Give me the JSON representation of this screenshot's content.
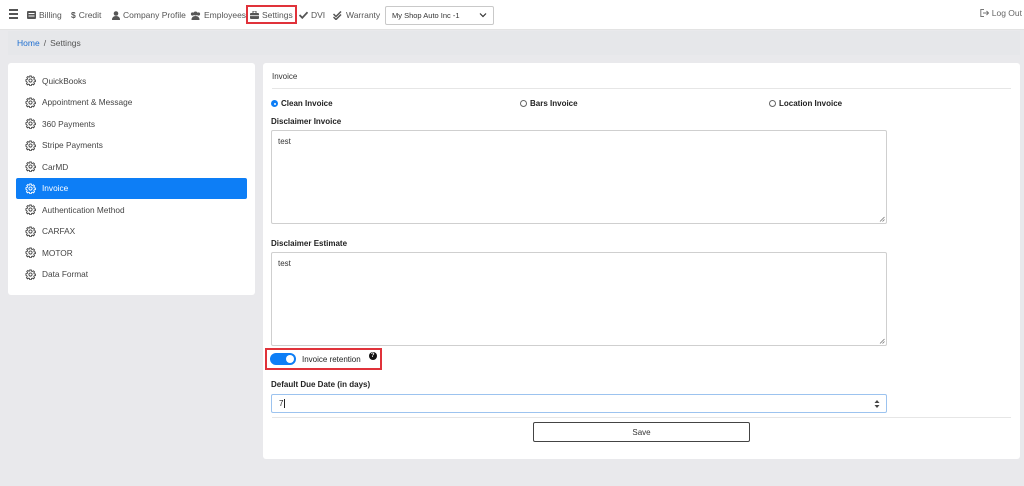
{
  "nav": {
    "items": [
      {
        "label": "Billing",
        "icon": "billing-icon"
      },
      {
        "label": "Credit",
        "icon": "dollar-icon"
      },
      {
        "label": "Company Profile",
        "icon": "user-icon"
      },
      {
        "label": "Employees",
        "icon": "users-icon"
      },
      {
        "label": "Settings",
        "icon": "toolbox-icon"
      },
      {
        "label": "DVI",
        "icon": "check-icon"
      },
      {
        "label": "Warranty",
        "icon": "double-check-icon"
      }
    ],
    "shop_select": "My Shop Auto Inc -1",
    "logout": "Log Out"
  },
  "breadcrumb": {
    "home": "Home",
    "separator": "/",
    "current": "Settings"
  },
  "sidebar": {
    "items": [
      {
        "label": "QuickBooks"
      },
      {
        "label": "Appointment & Message"
      },
      {
        "label": "360 Payments"
      },
      {
        "label": "Stripe Payments"
      },
      {
        "label": "CarMD"
      },
      {
        "label": "Invoice",
        "active": true
      },
      {
        "label": "Authentication Method"
      },
      {
        "label": "CARFAX"
      },
      {
        "label": "MOTOR"
      },
      {
        "label": "Data Format"
      }
    ]
  },
  "invoice": {
    "title": "Invoice",
    "options": [
      {
        "label": "Clean Invoice",
        "checked": true
      },
      {
        "label": "Bars Invoice",
        "checked": false
      },
      {
        "label": "Location Invoice",
        "checked": false
      }
    ],
    "disclaimer_invoice_label": "Disclaimer Invoice",
    "disclaimer_invoice_value": "test",
    "disclaimer_estimate_label": "Disclaimer Estimate",
    "disclaimer_estimate_value": "test",
    "retention_label": "Invoice retention",
    "retention_enabled": true,
    "help_glyph": "?",
    "due_date_label": "Default Due Date (in days)",
    "due_date_value": "7",
    "save_label": "Save"
  },
  "colors": {
    "accent": "#0d7ef6",
    "highlight": "#e0323a",
    "link": "#1f6fd1"
  }
}
